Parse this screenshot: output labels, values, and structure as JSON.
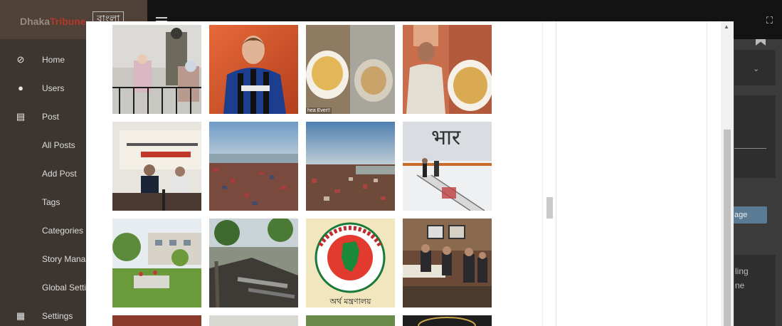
{
  "topbar": {
    "brand_left_a": "Dhaka",
    "brand_left_b": "Tribune",
    "brand_right": "বাংলা"
  },
  "sidebar": {
    "items": [
      {
        "label": "Home",
        "icon": "compass-icon"
      },
      {
        "label": "Users",
        "icon": "user-icon"
      },
      {
        "label": "Post",
        "icon": "post-icon"
      },
      {
        "label": "All Posts"
      },
      {
        "label": "Add Post"
      },
      {
        "label": "Tags"
      },
      {
        "label": "Categories"
      },
      {
        "label": "Story Mana"
      },
      {
        "label": "Global Setti"
      },
      {
        "label": "Settings",
        "icon": "grid-icon"
      }
    ]
  },
  "background": {
    "button_fragment": "age",
    "text_fragment_1": "ling",
    "text_fragment_2": "ne"
  },
  "gallery": {
    "tiles": [
      {
        "name": "detention-photo",
        "caption": ""
      },
      {
        "name": "footballer-photo",
        "caption": ""
      },
      {
        "name": "food-bowl-photo",
        "caption": "hea Ever!!"
      },
      {
        "name": "wedding-food-photo",
        "caption": ""
      },
      {
        "name": "press-briefing-photo",
        "caption": ""
      },
      {
        "name": "crowd-beach-photo",
        "caption": ""
      },
      {
        "name": "crowd-shore-photo",
        "caption": ""
      },
      {
        "name": "airplane-photo",
        "caption": ""
      },
      {
        "name": "garden-building-photo",
        "caption": ""
      },
      {
        "name": "fire-damage-photo",
        "caption": ""
      },
      {
        "name": "finance-ministry-seal",
        "caption": ""
      },
      {
        "name": "award-ceremony-photo",
        "caption": ""
      }
    ],
    "seal_bottom_text": "অর্থ মন্ত্রণালয়"
  },
  "colors": {
    "topbar": "#131313",
    "sidebar": "#3d3630",
    "modal": "#ffffff",
    "accent_button": "#5b7b95"
  }
}
